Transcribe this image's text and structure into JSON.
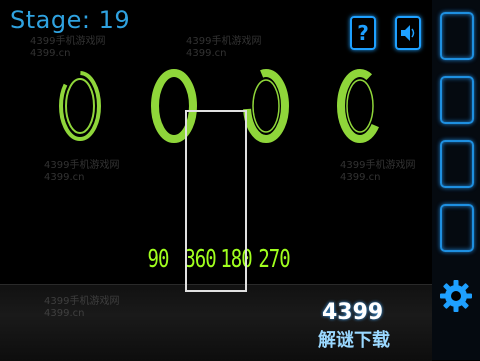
{
  "header": {
    "stage_label": "Stage: 19"
  },
  "buttons": {
    "help_label": "?"
  },
  "rings": [
    {
      "id": "ring-1",
      "open_side": "top-left",
      "color": "#8fd63a"
    },
    {
      "id": "ring-2",
      "open_side": "none",
      "color": "#8fd63a"
    },
    {
      "id": "ring-3",
      "open_side": "top-left",
      "color": "#8fd63a"
    },
    {
      "id": "ring-4",
      "open_side": "left",
      "color": "#8fd63a"
    }
  ],
  "readouts": [
    "90",
    "360",
    "180",
    "270"
  ],
  "side_slots": 4,
  "watermarks": [
    "4399手机游戏网\n4399.cn",
    "4399手机游戏网\n4399.cn",
    "4399手机游戏网\n4399.cn",
    "4399手机游戏网\n4399.cn",
    "4399手机游戏网\n4399.cn"
  ],
  "brand": {
    "main": "4399",
    "sub": "解谜下载"
  },
  "colors": {
    "accent_blue": "#1ea0ff",
    "ring_green": "#8fd63a",
    "readout_green": "#a0ff1e",
    "title_blue": "#2fa2e0"
  }
}
